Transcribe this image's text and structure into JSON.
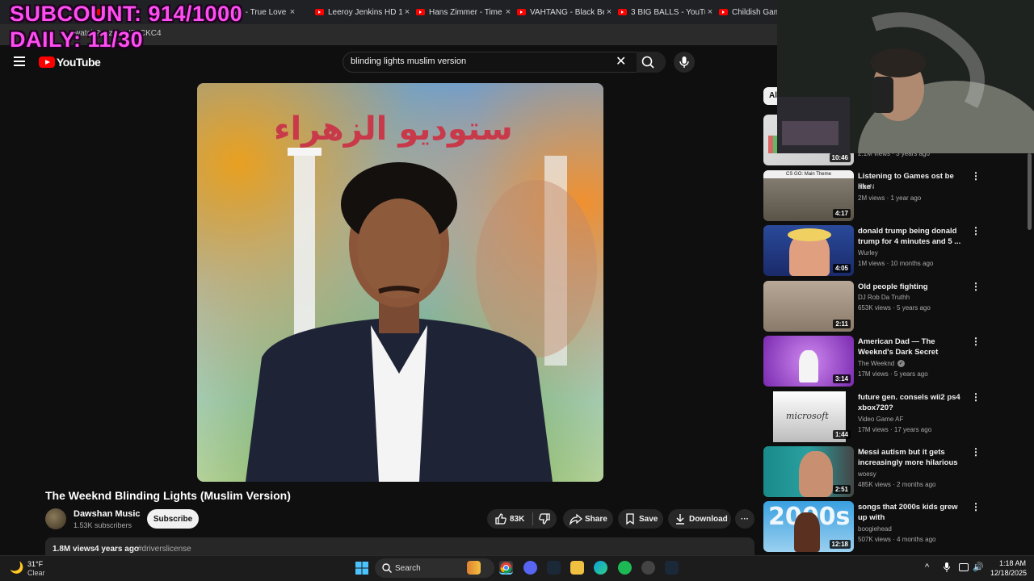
{
  "overlay": {
    "subcount": "SUBCOUNT: 914/1000",
    "daily": "DAILY: 11/30"
  },
  "browser": {
    "tabs": [
      {
        "title": "T...",
        "close": "×"
      },
      {
        "title": "Coldplay - True Love (",
        "close": "×"
      },
      {
        "title": "Leeroy Jenkins HD 10(",
        "close": "×"
      },
      {
        "title": "Hans Zimmer - Time (",
        "close": "×"
      },
      {
        "title": "VAHTANG - Black Bet",
        "close": "×"
      },
      {
        "title": "3 BIG BALLS - YouTub",
        "close": "×"
      },
      {
        "title": "Childish Gambin",
        "close": ""
      }
    ],
    "url": "watch?v=zj4CNZsCKC4"
  },
  "youtube": {
    "logo": "YouTube",
    "search_query": "blinding lights muslim version",
    "clear_symbol": "✕",
    "video_title": "The Weeknd Blinding Lights (Muslim Version)",
    "channel": {
      "name": "Dawshan Music",
      "subs": "1.53K subscribers",
      "subscribe_label": "Subscribe"
    },
    "actions": {
      "likes": "83K",
      "share": "Share",
      "save": "Save",
      "download": "Download",
      "more": "···"
    },
    "description": {
      "views": "1.8M views",
      "ago": "4 years ago",
      "tag": "#driverslicense"
    },
    "chip_all": "Al",
    "recommendations": [
      {
        "title": "",
        "channel": "",
        "meta": "2.1M views · 3 years ago",
        "duration": "10:46"
      },
      {
        "title": "Listening to Games ost be like",
        "channel": "NooN",
        "meta": "2M views · 1 year ago",
        "duration": "4:17",
        "thumb_label": "CS GO: Main Theme"
      },
      {
        "title": "donald trump being donald trump for 4 minutes and 5 ...",
        "channel": "Wurley",
        "meta": "1M views · 10 months ago",
        "duration": "4:05"
      },
      {
        "title": "Old people fighting",
        "channel": "DJ Rob Da Truthh",
        "meta": "653K views · 5 years ago",
        "duration": "2:11"
      },
      {
        "title": "American Dad — The Weeknd's Dark Secret",
        "channel": "The Weeknd",
        "meta": "17M views · 5 years ago",
        "duration": "3:14",
        "verified": true
      },
      {
        "title": "future gen. consels wii2 ps4 xbox720?",
        "channel": "Video Game AF",
        "meta": "17M views · 17 years ago",
        "duration": "1:44",
        "thumb_label": "microsoft"
      },
      {
        "title": "Messi autism but it gets increasingly more hilarious",
        "channel": "woesy",
        "meta": "485K views · 2 months ago",
        "duration": "2:51"
      },
      {
        "title": "songs that 2000s kids grew up with",
        "channel": "boogiehead",
        "meta": "507K views · 4 months ago",
        "duration": "12:18"
      }
    ],
    "video_overlay_text": "ستوديو الزهراء"
  },
  "taskbar": {
    "weather_temp": "31°F",
    "weather_desc": "Clear",
    "search_label": "Search",
    "time": "1:18 AM",
    "date": "12/18/2025"
  },
  "colors": {
    "accent": "#ff0000",
    "overlay_text": "#ff4df2",
    "background": "#0f0f0f"
  }
}
